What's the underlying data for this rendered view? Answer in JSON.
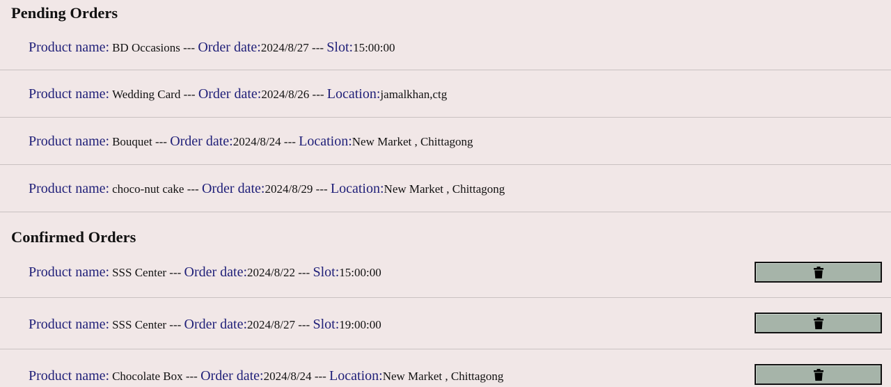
{
  "pending": {
    "title": "Pending Orders",
    "orders": [
      {
        "product_label": "Product name:",
        "product": "BD Occasions",
        "sep1": " --- ",
        "date_label": "Order date:",
        "date": "2024/8/27",
        "sep2": " --- ",
        "extra_label": "Slot:",
        "extra": "15:00:00"
      },
      {
        "product_label": "Product name:",
        "product": "Wedding Card",
        "sep1": " --- ",
        "date_label": "Order date:",
        "date": "2024/8/26",
        "sep2": " --- ",
        "extra_label": "Location:",
        "extra": "jamalkhan,ctg"
      },
      {
        "product_label": "Product name:",
        "product": "Bouquet",
        "sep1": " --- ",
        "date_label": "Order date:",
        "date": "2024/8/24",
        "sep2": " --- ",
        "extra_label": "Location:",
        "extra": "New Market , Chittagong"
      },
      {
        "product_label": "Product name:",
        "product": "choco-nut cake",
        "sep1": " --- ",
        "date_label": "Order date:",
        "date": "2024/8/29",
        "sep2": " --- ",
        "extra_label": "Location:",
        "extra": "New Market , Chittagong"
      }
    ]
  },
  "confirmed": {
    "title": "Confirmed Orders",
    "delete_icon": "trash-icon",
    "orders": [
      {
        "product_label": "Product name:",
        "product": "SSS Center",
        "sep1": " --- ",
        "date_label": "Order date:",
        "date": "2024/8/22",
        "sep2": " --- ",
        "extra_label": "Slot:",
        "extra": "15:00:00"
      },
      {
        "product_label": "Product name:",
        "product": "SSS Center",
        "sep1": " --- ",
        "date_label": "Order date:",
        "date": "2024/8/27",
        "sep2": " --- ",
        "extra_label": "Slot:",
        "extra": "19:00:00"
      },
      {
        "product_label": "Product name:",
        "product": "Chocolate Box",
        "sep1": " --- ",
        "date_label": "Order date:",
        "date": "2024/8/24",
        "sep2": " --- ",
        "extra_label": "Location:",
        "extra": "New Market , Chittagong"
      }
    ]
  },
  "colors": {
    "background": "#f1e7e7",
    "label": "#1f1f78",
    "button": "#a6b4a9",
    "divider": "#c9c1c1"
  }
}
